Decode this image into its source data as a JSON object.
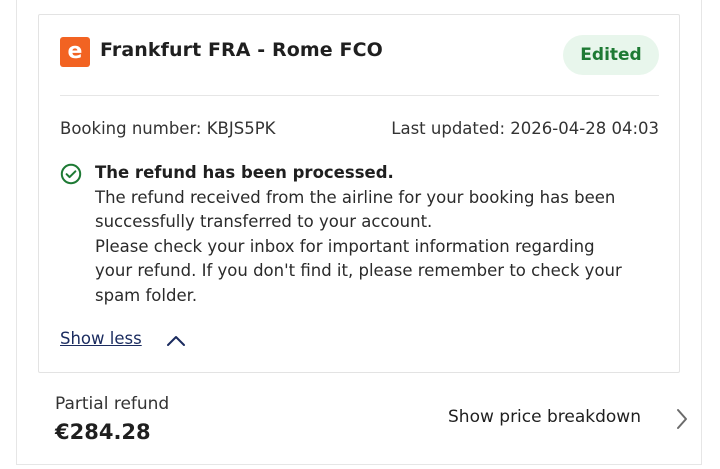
{
  "booking": {
    "brand_letter": "e",
    "route": "Frankfurt FRA - Rome FCO",
    "status_badge": "Edited",
    "booking_number_text": "Booking number: KBJS5PK",
    "last_updated_text": "Last updated: 2026-04-28 04:03"
  },
  "notice": {
    "title": "The refund has been processed.",
    "lines": [
      "The refund received from the airline for your booking has been",
      "successfully transferred to your account.",
      "Please check your inbox for important information regarding",
      "your refund. If you don't find it, please remember to check your",
      "spam folder."
    ],
    "icon": "check-circle-icon"
  },
  "toggle": {
    "label": "Show less",
    "icon": "chevron-up-icon"
  },
  "refund": {
    "label": "Partial refund",
    "amount": "€284.28",
    "breakdown_label": "Show price breakdown",
    "breakdown_icon": "chevron-right-icon"
  },
  "colors": {
    "brand": "#f26322",
    "badge_bg": "#e8f6ec",
    "badge_text": "#1e7a34",
    "link": "#1a2b5f",
    "check": "#1e7a34"
  }
}
